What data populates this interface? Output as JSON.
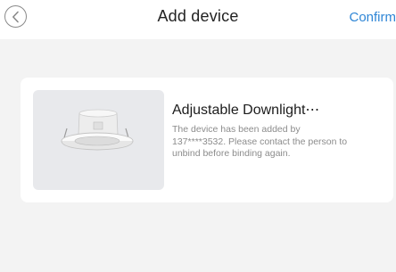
{
  "header": {
    "title": "Add device",
    "confirm_label": "Confirm"
  },
  "device": {
    "name": "Adjustable Downlight⋯",
    "message": "The device has been added by 137****3532. Please contact the person to unbind before binding again."
  },
  "colors": {
    "accent": "#2f86d6",
    "background": "#f3f3f3",
    "card": "#ffffff",
    "thumbnail_bg": "#e8e9ec"
  },
  "icons": {
    "back": "chevron-left-icon",
    "device_image": "downlight-icon"
  }
}
